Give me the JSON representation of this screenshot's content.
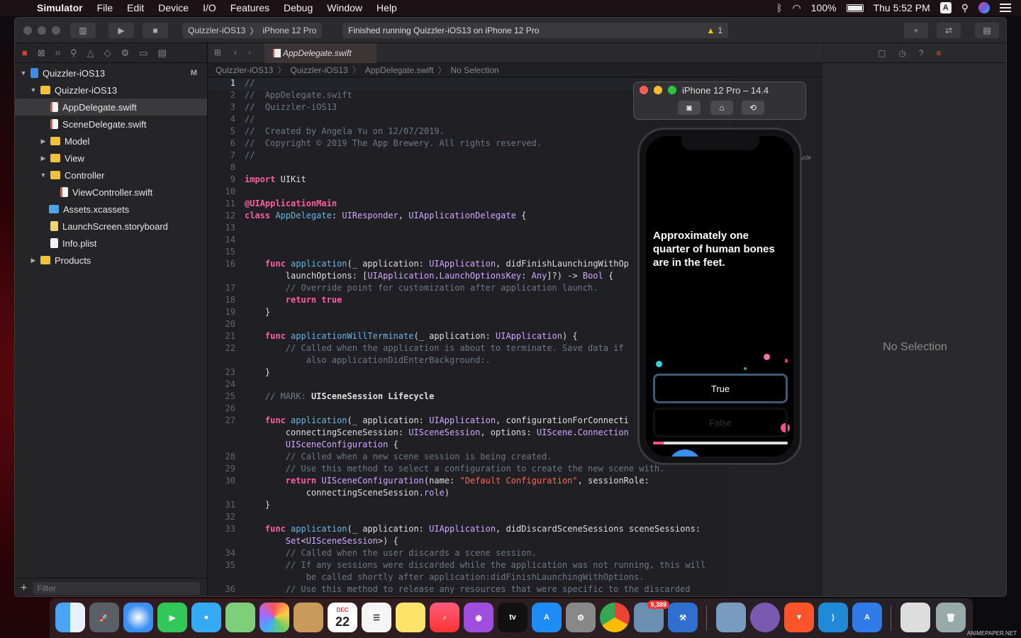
{
  "menubar": {
    "app": "Simulator",
    "items": [
      "File",
      "Edit",
      "Device",
      "I/O",
      "Features",
      "Debug",
      "Window",
      "Help"
    ],
    "battery": "100%",
    "clock": "Thu 5:52 PM",
    "input_source": "A"
  },
  "toolbar": {
    "scheme_target": "Quizzler-iOS13",
    "scheme_device": "iPhone 12 Pro",
    "status": "Finished running Quizzler-iOS13 on iPhone 12 Pro",
    "warning_count": "1"
  },
  "navigator": {
    "items": [
      {
        "label": "Quizzler-iOS13",
        "badge": "M"
      },
      {
        "label": "Quizzler-iOS13"
      },
      {
        "label": "AppDelegate.swift"
      },
      {
        "label": "SceneDelegate.swift"
      },
      {
        "label": "Model"
      },
      {
        "label": "View"
      },
      {
        "label": "Controller"
      },
      {
        "label": "ViewController.swift"
      },
      {
        "label": "Assets.xcassets"
      },
      {
        "label": "LaunchScreen.storyboard"
      },
      {
        "label": "Info.plist"
      },
      {
        "label": "Products"
      }
    ],
    "filter_placeholder": "Filter"
  },
  "editor": {
    "tab": "AppDelegate.swift",
    "jumpbar": [
      "Quizzler-iOS13",
      "Quizzler-iOS13",
      "AppDelegate.swift",
      "No Selection"
    ],
    "minimap_label": "cycle"
  },
  "inspector": {
    "empty": "No Selection"
  },
  "simulator": {
    "title": "iPhone 12 Pro – 14.4",
    "question": "Approximately one quarter of human bones are in the feet.",
    "true_label": "True",
    "false_label": "False",
    "progress": 0.08
  },
  "dock": {
    "calendar_month": "DEC",
    "calendar_day": "22",
    "mail_badge": "9,389",
    "tv_label": "tv"
  },
  "watermark": "ANIMEPAPER.NET",
  "icons": [
    "apple-icon",
    "bluetooth-icon",
    "wifi-icon",
    "battery-icon",
    "search-icon",
    "siri-icon",
    "control-center-icon"
  ]
}
